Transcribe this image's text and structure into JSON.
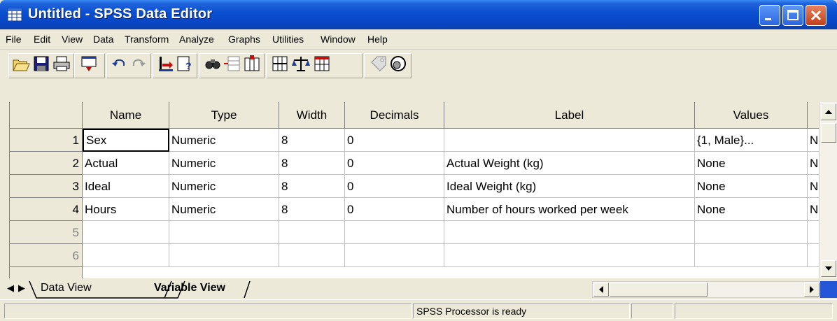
{
  "window": {
    "title": "Untitled - SPSS Data Editor",
    "icon": "spss-grid-icon"
  },
  "menu": [
    "File",
    "Edit",
    "View",
    "Data",
    "Transform",
    "Analyze",
    "Graphs",
    "Utilities",
    "Window",
    "Help"
  ],
  "toolbar": {
    "buttons": [
      "open-file-icon",
      "save-icon",
      "print-icon",
      "dialog-recall-icon",
      "undo-icon",
      "redo-icon",
      "goto-case-icon",
      "variables-icon",
      "find-icon",
      "insert-cases-icon",
      "insert-variable-icon",
      "split-file-icon",
      "weight-cases-icon",
      "select-cases-icon",
      "value-labels-icon",
      "use-sets-icon"
    ]
  },
  "grid": {
    "columns": [
      "Name",
      "Type",
      "Width",
      "Decimals",
      "Label",
      "Values",
      ""
    ],
    "rows": [
      {
        "num": "1",
        "name": "Sex",
        "type": "Numeric",
        "width": "8",
        "decimals": "0",
        "label": "",
        "values": "{1, Male}...",
        "missing": "N"
      },
      {
        "num": "2",
        "name": "Actual",
        "type": "Numeric",
        "width": "8",
        "decimals": "0",
        "label": "Actual Weight (kg)",
        "values": "None",
        "missing": "N"
      },
      {
        "num": "3",
        "name": "Ideal",
        "type": "Numeric",
        "width": "8",
        "decimals": "0",
        "label": "Ideal Weight (kg)",
        "values": "None",
        "missing": "N"
      },
      {
        "num": "4",
        "name": "Hours",
        "type": "Numeric",
        "width": "8",
        "decimals": "0",
        "label": "Number of hours worked per week",
        "values": "None",
        "missing": "N"
      },
      {
        "num": "5",
        "name": "",
        "type": "",
        "width": "",
        "decimals": "",
        "label": "",
        "values": "",
        "missing": ""
      },
      {
        "num": "6",
        "name": "",
        "type": "",
        "width": "",
        "decimals": "",
        "label": "",
        "values": "",
        "missing": ""
      }
    ]
  },
  "tabs": {
    "data_view": "Data View",
    "variable_view": "Variable View",
    "active": "variable_view"
  },
  "status": {
    "processor": "SPSS Processor  is ready"
  },
  "colors": {
    "titlebar": "#0A4ED0",
    "chrome": "#ECE9D8"
  }
}
